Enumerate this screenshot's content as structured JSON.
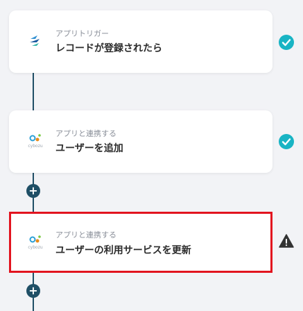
{
  "flow": {
    "steps": [
      {
        "label": "アプリトリガー",
        "title": "レコードが登録されたら",
        "app_icon": "kintone-icon",
        "status_icon": "check-circle-icon"
      },
      {
        "label": "アプリと連携する",
        "title": "ユーザーを追加",
        "app_icon": "cybozu-icon",
        "app_icon_text": "cybozu",
        "status_icon": "check-circle-icon"
      },
      {
        "label": "アプリと連携する",
        "title": "ユーザーの利用サービスを更新",
        "app_icon": "cybozu-icon",
        "app_icon_text": "cybozu",
        "status_icon": "warning-icon"
      }
    ],
    "add_button_label": "+",
    "colors": {
      "background": "#f2f3f6",
      "connector": "#1f4f66",
      "check": "#19b4c4",
      "warning": "#333333",
      "highlight_border": "#e2141f"
    }
  }
}
